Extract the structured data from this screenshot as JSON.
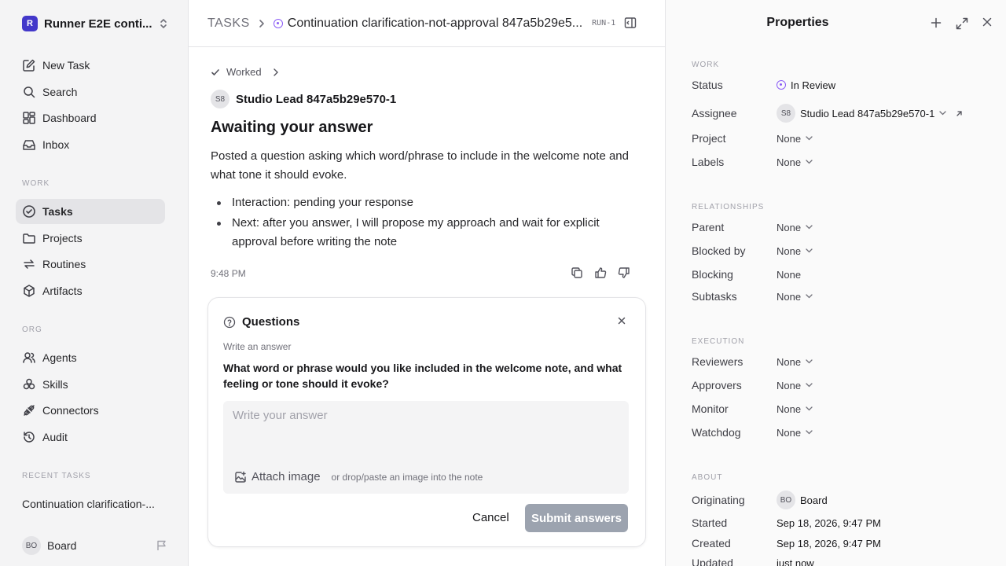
{
  "workspace": {
    "logo": "R",
    "name": "Runner E2E conti..."
  },
  "nav": [
    {
      "label": "New Task",
      "icon": "new-task-icon"
    },
    {
      "label": "Search",
      "icon": "search-icon"
    },
    {
      "label": "Dashboard",
      "icon": "dashboard-icon"
    },
    {
      "label": "Inbox",
      "icon": "inbox-icon"
    }
  ],
  "work_section": {
    "label": "WORK",
    "items": [
      {
        "label": "Tasks",
        "icon": "tasks-icon",
        "active": true
      },
      {
        "label": "Projects",
        "icon": "folder-icon"
      },
      {
        "label": "Routines",
        "icon": "routines-icon"
      },
      {
        "label": "Artifacts",
        "icon": "artifacts-icon"
      }
    ]
  },
  "org_section": {
    "label": "ORG",
    "items": [
      {
        "label": "Agents",
        "icon": "agents-icon"
      },
      {
        "label": "Skills",
        "icon": "skills-icon"
      },
      {
        "label": "Connectors",
        "icon": "connectors-icon"
      },
      {
        "label": "Audit",
        "icon": "audit-icon"
      }
    ]
  },
  "recent": {
    "label": "RECENT TASKS",
    "item": "Continuation clarification-..."
  },
  "user": {
    "initials": "BO",
    "name": "Board"
  },
  "header": {
    "root": "TASKS",
    "title": "Continuation clarification-not-approval 847a5b29e5...",
    "run_badge": "RUN-1"
  },
  "message": {
    "worked_label": "Worked",
    "agent_initials": "S8",
    "agent_name": "Studio Lead 847a5b29e570-1",
    "title": "Awaiting your answer",
    "body": "Posted a question asking which word/phrase to include in the welcome note and what tone it should evoke.",
    "bullets": [
      "Interaction: pending your response",
      "Next: after you answer, I will propose my approach and wait for explicit approval before writing the note"
    ],
    "time": "9:48 PM"
  },
  "question_card": {
    "title": "Questions",
    "subtitle": "Write an answer",
    "question": "What word or phrase would you like included in the welcome note, and what feeling or tone should it evoke?",
    "placeholder": "Write your answer",
    "attach_label": "Attach image",
    "attach_hint": "or drop/paste an image into the note",
    "cancel_label": "Cancel",
    "submit_label": "Submit answers",
    "submit_color": "#9ca3af"
  },
  "properties": {
    "title": "Properties",
    "work": {
      "label": "WORK",
      "status": {
        "key": "Status",
        "value": "In Review",
        "color": "#8b5cf6"
      },
      "assignee": {
        "key": "Assignee",
        "initials": "S8",
        "value": "Studio Lead 847a5b29e570-1"
      },
      "project": {
        "key": "Project",
        "value": "None"
      },
      "labels": {
        "key": "Labels",
        "value": "None"
      }
    },
    "relationships": {
      "label": "RELATIONSHIPS",
      "parent": {
        "key": "Parent",
        "value": "None"
      },
      "blocked_by": {
        "key": "Blocked by",
        "value": "None"
      },
      "blocking": {
        "key": "Blocking",
        "value": "None"
      },
      "subtasks": {
        "key": "Subtasks",
        "value": "None"
      }
    },
    "execution": {
      "label": "EXECUTION",
      "reviewers": {
        "key": "Reviewers",
        "value": "None"
      },
      "approvers": {
        "key": "Approvers",
        "value": "None"
      },
      "monitor": {
        "key": "Monitor",
        "value": "None"
      },
      "watchdog": {
        "key": "Watchdog",
        "value": "None"
      }
    },
    "about": {
      "label": "ABOUT",
      "originating": {
        "key": "Originating",
        "initials": "BO",
        "value": "Board"
      },
      "started": {
        "key": "Started",
        "value": "Sep 18, 2026, 9:47 PM"
      },
      "created": {
        "key": "Created",
        "value": "Sep 18, 2026, 9:47 PM"
      },
      "updated": {
        "key": "Updated",
        "value": "just now"
      }
    }
  }
}
